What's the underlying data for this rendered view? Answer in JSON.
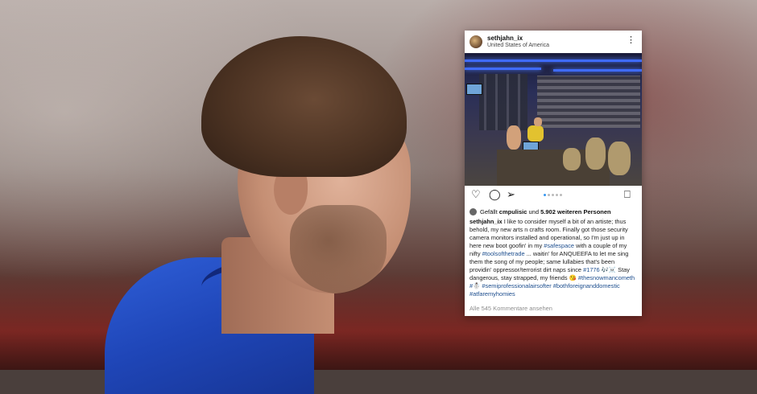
{
  "post": {
    "username": "sethjahn_ix",
    "location": "United States of America",
    "more_icon": "⋮",
    "likes": {
      "prefix": "Gefällt",
      "user": "cmpulisic",
      "middle": "und",
      "count_text": "5.902 weiteren Personen"
    },
    "caption": {
      "user": "sethjahn_ix",
      "part1": "I like to consider myself a bit of an artiste; thus behold, my new arts n crafts room. Finally got those security camera monitors installed and operational, so I'm just up in here new boot goofin' in my",
      "tag1": "#safespace",
      "part2": "with a couple of my nifty",
      "tag2": "#toolsofthetrade",
      "part3": "... waitin' for ANQUEEFA to let me sing them the song of my people; same lullabies that's been providin' oppressor/terrorist dirt naps since",
      "tag3": "#1776",
      "part4": "🎶☠️ Stay dangerous, stay strapped, my friends 😘",
      "tag4": "#thesnowmancometh",
      "part5": "#☃️",
      "tag5": "#semiprofessionalairsofter",
      "tag6": "#bothforeignanddomestic",
      "tag7": "#atfaremyhomies"
    },
    "comments_link": "Alle 545 Kommentare ansehen",
    "carousel": {
      "count": 5,
      "active": 0
    },
    "icons": {
      "like": "heart-icon",
      "comment": "comment-icon",
      "share": "send-icon",
      "save": "bookmark-icon"
    },
    "colors": {
      "tag": "#1d4e8e",
      "carousel_active": "#3897f0",
      "led": "#3f6bff"
    }
  }
}
